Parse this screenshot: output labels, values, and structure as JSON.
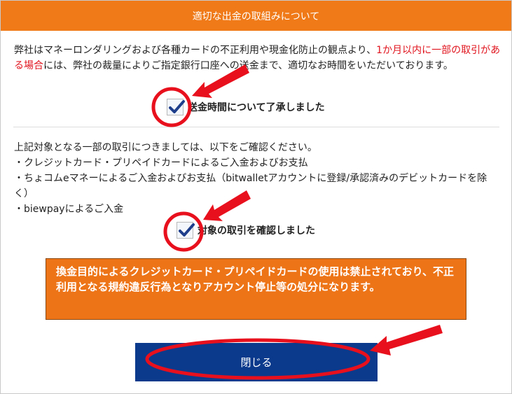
{
  "modal": {
    "title": "適切な出金の取組みについて",
    "intro": {
      "text_before": "弊社はマネーロンダリングおよび各種カードの不正利用や現金化防止の観点より、",
      "text_highlight": "1か月以内に一部の取引がある場合",
      "text_after": "には、弊社の裁量によりご指定銀行口座への送金まで、適切なお時間をいただいております。"
    },
    "checkbox_transfer_time": {
      "label": "送金時間について了承しました",
      "checked": true
    },
    "transactions": {
      "lead": "上記対象となる一部の取引につきましては、以下をご確認ください。",
      "items": [
        "・クレジットカード・プリペイドカードによるご入金およびお支払",
        "・ちょコムeマネーによるご入金およびお支払（bitwalletアカウントに登録/承認済みのデビットカードを除く）",
        "・biewpayによるご入金"
      ]
    },
    "checkbox_transactions": {
      "label": "対象の取引を確認しました",
      "checked": true
    },
    "warning": "換金目的によるクレジットカード・プリペイドカードの使用は禁止されており、不正利用となる規約違反行為となりアカウント停止等の処分になります。",
    "close_button": "閉じる"
  },
  "colors": {
    "header": "#ef7a17",
    "highlight_text": "#e0141e",
    "warning_bg": "#ee7418",
    "button_bg": "#0b3a8d",
    "annotation_red": "#e8101c",
    "check_color": "#1e3e8c"
  }
}
